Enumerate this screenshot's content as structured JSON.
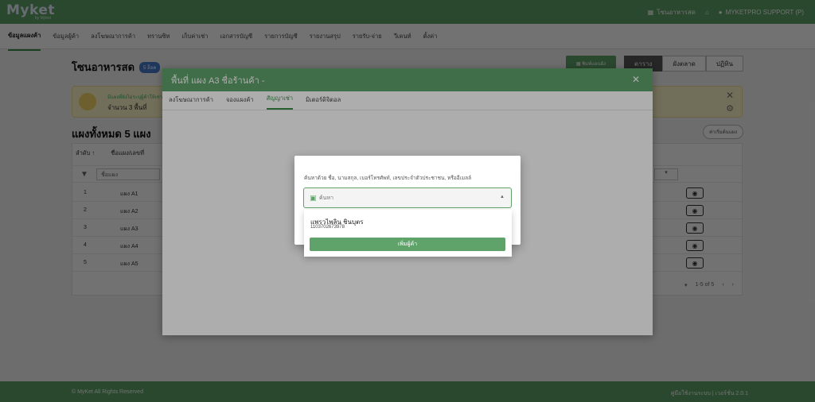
{
  "app": {
    "logo": "Myket",
    "logo_sub": "by Myket"
  },
  "topbar": {
    "market": "โซนอาหารสด",
    "user": "MYKETPRO SUPPORT (P)"
  },
  "nav": [
    "ข้อมูลแผงค้า",
    "ข้อมูลผู้ค้า",
    "ลงโฆษณาการค้า",
    "ทรานซิท",
    "เก็บค่าเช่า",
    "เอกสารบัญชี",
    "รายการบัญชี",
    "รายงานสรุป",
    "รายรับ-จ่าย",
    "วีเคนท์",
    "ตั้งค่า"
  ],
  "page": {
    "title": "โซนอาหารสด",
    "badge": "5 ล็อค",
    "btn_print": "พิมพ์แผนผัง",
    "btn_table": "ตาราง",
    "btn_layout": "ผังตลาด",
    "btn_calendar": "ปฏิทิน",
    "banner_l1": "มีแผงที่ยังไม่ระบุผู้ค้าให้เช่า",
    "banner_l2": "จำนวน 3 พื้นที่",
    "count_title": "แผงทั้งหมด 5 แผง",
    "link_btn": "ค่าเริ่มต้นแผง",
    "sort_label": "ลำดับ ↑",
    "sort_col": "ชื่อแผง/เลขที่",
    "filter_placeholder": "ชื่อแผง",
    "rows": [
      {
        "no": "1",
        "name": "แผง A1"
      },
      {
        "no": "2",
        "name": "แผง A2"
      },
      {
        "no": "3",
        "name": "แผง A3"
      },
      {
        "no": "4",
        "name": "แผง A4"
      },
      {
        "no": "5",
        "name": "แผง A5"
      }
    ],
    "pager": "1-5 of 5"
  },
  "footer": {
    "left": "© MyKet All Rights Reserved",
    "right": "คู่มือใช้งานระบบ | เวอร์ชั่น 2.0.1"
  },
  "modal": {
    "title": "พื้นที่ แผง A3  ชื่อร้านค้า -",
    "tabs": [
      "ลงโฆษณาการค้า",
      "จองแผงค้า",
      "สัญญาเช่า",
      "มิเตอร์ดิจิตอล"
    ]
  },
  "dialog": {
    "label": "ค้นหาด้วย ชื่อ, นามสกุล, เบอร์โทรศัพท์, เลขประจำตัวประชาชน, หรืออีเมลล์",
    "placeholder": "ค้นหา",
    "option_name": "แพรวไพลิน ชินบุตร",
    "option_id": "1103702673978",
    "add_button": "เพิ่มผู้ค้า"
  },
  "colors": {
    "primary": "#5fa36a",
    "badge": "#4a7bd1"
  }
}
